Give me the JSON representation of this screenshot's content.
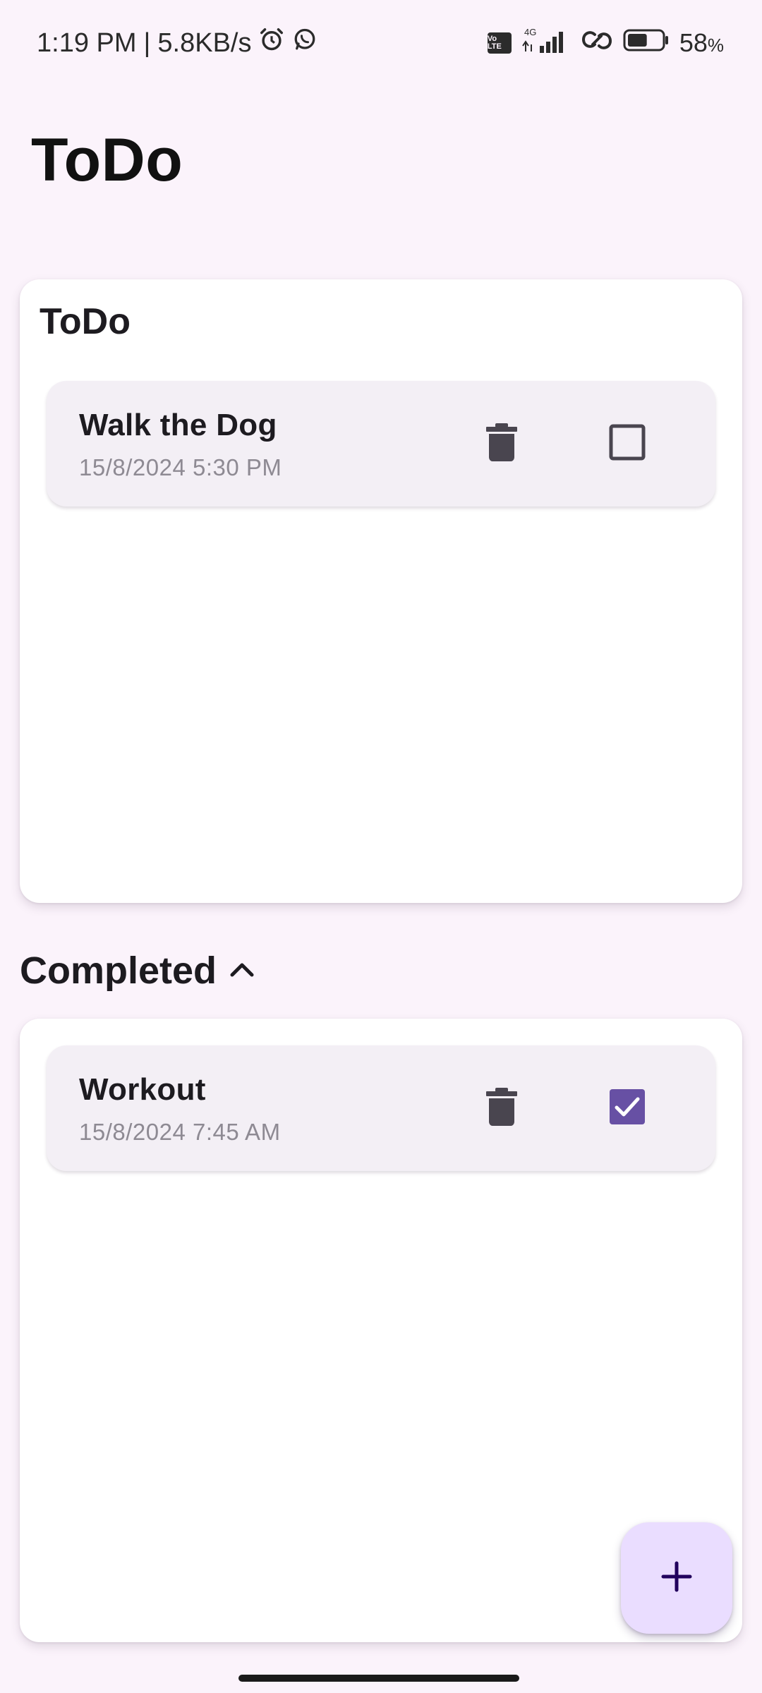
{
  "status_bar": {
    "time": "1:19 PM",
    "separator": "|",
    "speed": "5.8KB/s",
    "network_label": "4G",
    "volte_label": "Vo LTE",
    "battery_level": 58,
    "battery_text": "58",
    "battery_unit": "%",
    "icons": [
      "alarm-icon",
      "whatsapp-icon",
      "volte-icon",
      "signal-icon",
      "hotspot-icon",
      "battery-icon"
    ]
  },
  "app": {
    "title": "ToDo"
  },
  "todo_section": {
    "heading": "ToDo",
    "items": [
      {
        "title": "Walk the Dog",
        "datetime": "15/8/2024 5:30 PM",
        "completed": false,
        "delete_icon": "delete-icon",
        "checkbox_icon": "checkbox-unchecked-icon"
      }
    ]
  },
  "completed_section": {
    "heading": "Completed",
    "expanded": true,
    "toggle_icon": "chevron-up-icon",
    "items": [
      {
        "title": "Workout",
        "datetime": "15/8/2024 7:45 AM",
        "completed": true,
        "delete_icon": "delete-icon",
        "checkbox_icon": "checkbox-checked-icon"
      }
    ]
  },
  "fab": {
    "icon": "add-icon"
  },
  "colors": {
    "background": "#FBF3FB",
    "card": "#FFFFFF",
    "item_background": "#F3EFF5",
    "checked_box": "#6750A4",
    "fab_background": "#EADDFF",
    "fab_icon": "#21005D",
    "icon_dark": "#49454F",
    "secondary_text": "#8E8A93"
  }
}
